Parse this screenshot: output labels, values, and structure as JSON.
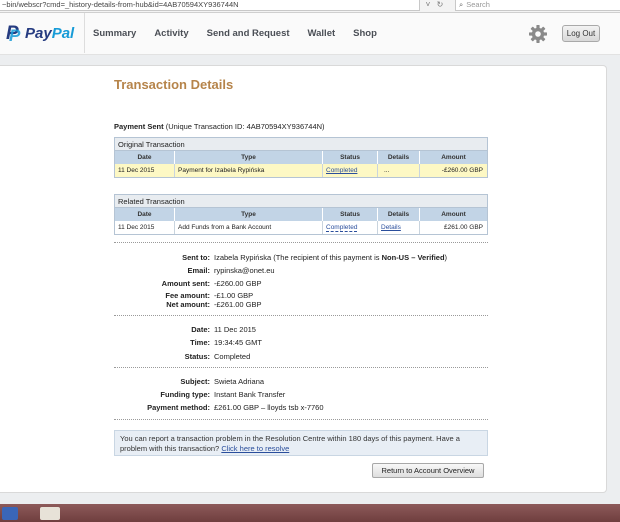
{
  "browser": {
    "url": "~bin/webscr?cmd=_history-details-from-hub&id=4AB70594XY936744N",
    "search_placeholder": "Search",
    "back_glyph": "˅",
    "reload_glyph": "↻",
    "search_glyph": "⌕"
  },
  "header": {
    "logo_pay": "Pay",
    "logo_pal": "Pal",
    "nav": [
      "Summary",
      "Activity",
      "Send and Request",
      "Wallet",
      "Shop"
    ],
    "logout_label": "Log Out"
  },
  "page": {
    "title": "Transaction Details",
    "payment_sent_label": "Payment Sent",
    "payment_sent_id": "(Unique Transaction ID: 4AB70594XY936744N)"
  },
  "original_transaction": {
    "caption": "Original Transaction",
    "headers": [
      "Date",
      "Type",
      "Status",
      "Details",
      "Amount"
    ],
    "row": {
      "date": "11 Dec 2015",
      "type": "Payment for Izabela Rypińska",
      "status": "Completed",
      "details": "...",
      "amount": "-£260.00 GBP"
    }
  },
  "related_transaction": {
    "caption": "Related Transaction",
    "headers": [
      "Date",
      "Type",
      "Status",
      "Details",
      "Amount"
    ],
    "row": {
      "date": "11 Dec 2015",
      "type": "Add Funds from a Bank Account",
      "status": "Completed",
      "details": "Details",
      "amount": "£261.00 GBP"
    }
  },
  "details": {
    "sent_to_label": "Sent to:",
    "sent_to_name": "Izabela Rypińska",
    "sent_to_note_pre": "(The recipient of this payment is",
    "sent_to_note_bold": "Non-US – Verified",
    "sent_to_note_post": ")",
    "email_label": "Email:",
    "email": "rypinska@onet.eu",
    "amount_sent_label": "Amount sent:",
    "amount_sent": "-£260.00 GBP",
    "fee_label": "Fee amount:",
    "fee": "-£1.00 GBP",
    "net_label": "Net amount:",
    "net": "-£261.00 GBP",
    "date_label": "Date:",
    "date": "11 Dec 2015",
    "time_label": "Time:",
    "time": "19:34:45 GMT",
    "status_label": "Status:",
    "status": "Completed",
    "subject_label": "Subject:",
    "subject": "Swieta Adriana",
    "funding_label": "Funding type:",
    "funding": "Instant Bank Transfer",
    "method_label": "Payment method:",
    "method": "£261.00 GBP – lloyds tsb x-7760"
  },
  "notice": {
    "text": "You can report a transaction problem in the Resolution Centre within 180 days of this payment. Have a problem with this transaction?",
    "link": "Click here to resolve"
  },
  "return_button": "Return to Account Overview",
  "taskbar": {
    "icon_names": [
      "start-icon",
      "app-icon"
    ],
    "colors": [
      "#3a66b8",
      "#e7e2d8"
    ]
  }
}
